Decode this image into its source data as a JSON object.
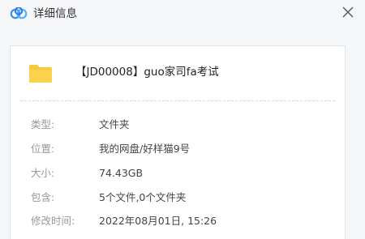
{
  "window": {
    "title": "详细信息"
  },
  "file": {
    "name": "【JD00008】guo家司fa考试"
  },
  "details": [
    {
      "label": "类型:",
      "value": "文件夹"
    },
    {
      "label": "位置:",
      "value": "我的网盘/好样猫9号"
    },
    {
      "label": "大小:",
      "value": "74.43GB"
    },
    {
      "label": "包含:",
      "value": "5个文件,0个文件夹"
    },
    {
      "label": "修改时间:",
      "value": "2022年08月01日, 15:26"
    }
  ],
  "colors": {
    "brand_blue": "#3e8cf4",
    "folder_yellow": "#f8c93d"
  },
  "icons": {
    "app": "baidu-netdisk-logo-icon",
    "close": "close-icon",
    "file": "folder-icon"
  }
}
